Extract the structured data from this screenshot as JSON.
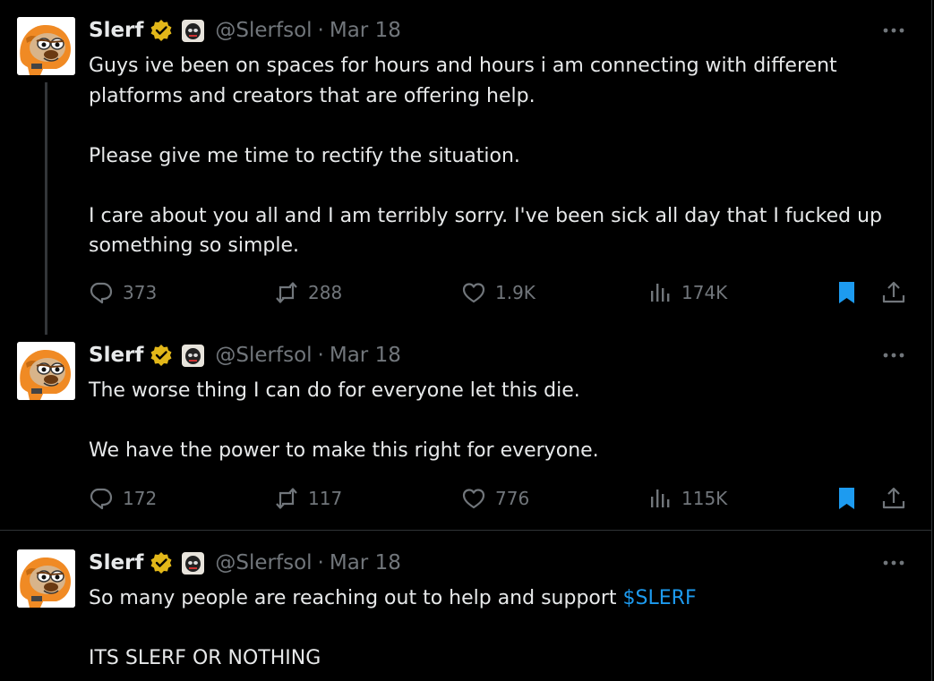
{
  "tweets": [
    {
      "author": "Slerf",
      "handle": "@Slerfsol",
      "separator": "·",
      "date": "Mar 18",
      "paragraphs": [
        "Guys ive been on spaces for hours and hours i am connecting with different platforms and creators that are offering help.",
        "Please give me time to rectify the situation.",
        "I care about you all and I am terribly sorry. I've been sick all day that I fucked up something so simple."
      ],
      "stats": {
        "replies": "373",
        "reposts": "288",
        "likes": "1.9K",
        "views": "174K"
      }
    },
    {
      "author": "Slerf",
      "handle": "@Slerfsol",
      "separator": "·",
      "date": "Mar 18",
      "paragraphs": [
        "The worse thing I can do for everyone let this die.",
        "We have the power to make this right for everyone."
      ],
      "stats": {
        "replies": "172",
        "reposts": "117",
        "likes": "776",
        "views": "115K"
      }
    },
    {
      "author": "Slerf",
      "handle": "@Slerfsol",
      "separator": "·",
      "date": "Mar 18",
      "line1_prefix": "So many people are reaching out to help and support ",
      "cashtag": "$SLERF",
      "line2": "ITS SLERF OR NOTHING"
    }
  ],
  "colors": {
    "background": "#000000",
    "text": "#e7e9ea",
    "muted": "#71767b",
    "accent": "#1d9bf0",
    "verified": "#e2b719"
  },
  "icons": [
    "more-icon",
    "verified-badge-icon",
    "affiliate-badge-icon",
    "reply-icon",
    "repost-icon",
    "like-icon",
    "views-icon",
    "bookmark-icon",
    "share-icon"
  ]
}
